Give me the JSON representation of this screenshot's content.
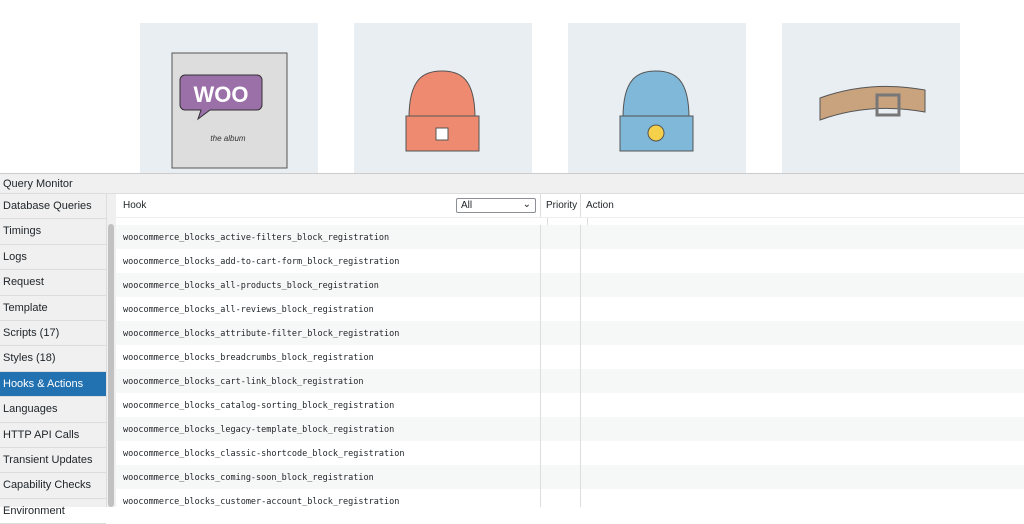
{
  "products": [
    {
      "name": "woo-album",
      "logo_text": "WOO",
      "sub_text": "the album"
    },
    {
      "name": "orange-beanie"
    },
    {
      "name": "blue-beanie"
    },
    {
      "name": "belt"
    }
  ],
  "panel": {
    "title": "Query Monitor"
  },
  "sidebar": {
    "items": [
      "Database Queries",
      "Timings",
      "Logs",
      "Request",
      "Template",
      "Scripts (17)",
      "Styles (18)",
      "Hooks & Actions",
      "Languages",
      "HTTP API Calls",
      "Transient Updates",
      "Capability Checks",
      "Environment"
    ],
    "active": "Hooks & Actions"
  },
  "table": {
    "headers": {
      "hook": "Hook",
      "priority": "Priority",
      "action": "Action"
    },
    "filter": {
      "selected": "All"
    },
    "rows": [
      "woocommerce_blocks_active-filters_block_registration",
      "woocommerce_blocks_add-to-cart-form_block_registration",
      "woocommerce_blocks_all-products_block_registration",
      "woocommerce_blocks_all-reviews_block_registration",
      "woocommerce_blocks_attribute-filter_block_registration",
      "woocommerce_blocks_breadcrumbs_block_registration",
      "woocommerce_blocks_cart-link_block_registration",
      "woocommerce_blocks_catalog-sorting_block_registration",
      "woocommerce_blocks_legacy-template_block_registration",
      "woocommerce_blocks_classic-shortcode_block_registration",
      "woocommerce_blocks_coming-soon_block_registration",
      "woocommerce_blocks_customer-account_block_registration"
    ]
  },
  "colors": {
    "accent": "#2271b1"
  }
}
